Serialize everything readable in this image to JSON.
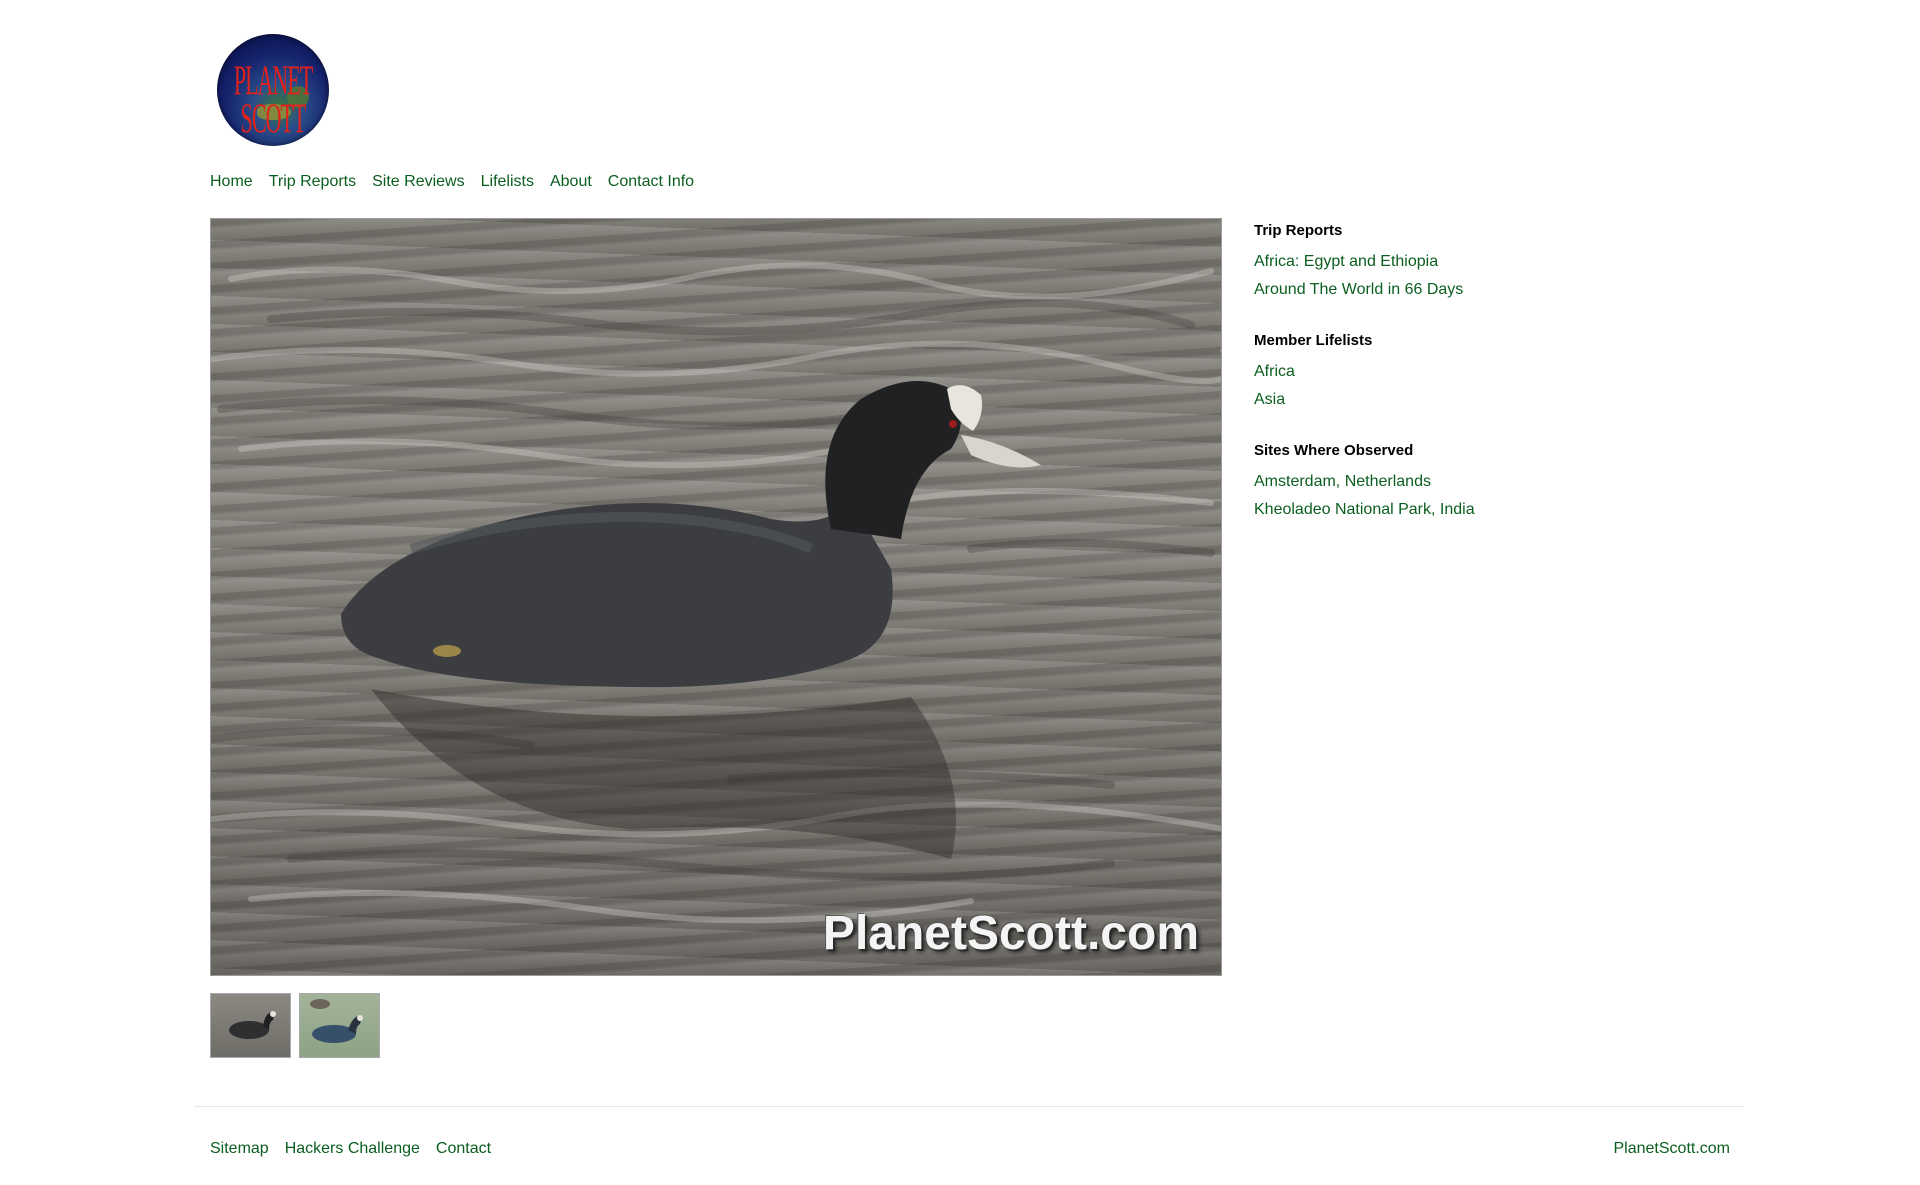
{
  "logo": {
    "text": "PLANET SCOTT"
  },
  "nav": {
    "items": [
      {
        "label": "Home"
      },
      {
        "label": "Trip Reports"
      },
      {
        "label": "Site Reviews"
      },
      {
        "label": "Lifelists"
      },
      {
        "label": "About"
      },
      {
        "label": "Contact Info"
      }
    ]
  },
  "photo": {
    "watermark": "PlanetScott.com"
  },
  "sidebar": {
    "trip_reports": {
      "heading": "Trip Reports",
      "links": [
        "Africa: Egypt and Ethiopia",
        "Around The World in 66 Days"
      ]
    },
    "member_lifelists": {
      "heading": "Member Lifelists",
      "links": [
        "Africa",
        "Asia"
      ]
    },
    "sites_observed": {
      "heading": "Sites Where Observed",
      "links": [
        "Amsterdam, Netherlands",
        "Kheoladeo National Park, India"
      ]
    }
  },
  "footer": {
    "links": [
      "Sitemap",
      "Hackers Challenge",
      "Contact"
    ],
    "brand": "PlanetScott.com"
  },
  "colors": {
    "link": "#0b5e1f",
    "text": "#000000",
    "background": "#ffffff"
  }
}
